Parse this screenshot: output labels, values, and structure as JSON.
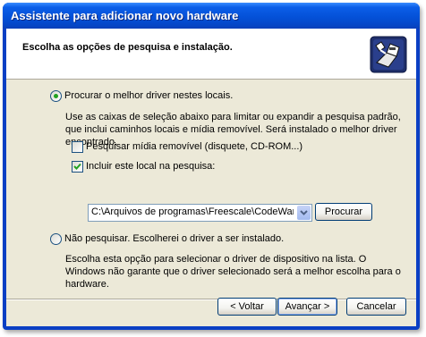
{
  "window": {
    "title": "Assistente para adicionar novo hardware"
  },
  "header": {
    "title": "Escolha as opções de pesquisa e instalação."
  },
  "options": {
    "search": {
      "label": "Procurar o melhor driver nestes locais.",
      "selected": true,
      "description": "Use as caixas de seleção abaixo para limitar ou expandir a pesquisa padrão, que inclui caminhos locais e mídia removível. Será instalado o melhor driver encontrado.",
      "removable_media": {
        "label": "Pesquisar mídia removível (disquete, CD-ROM...)",
        "checked": false
      },
      "include_location": {
        "label": "Incluir este local na pesquisa:",
        "checked": true
      },
      "path_value": "C:\\Arquivos de programas\\Freescale\\CodeWarrior fo",
      "browse_label": "Procurar"
    },
    "manual": {
      "label": "Não pesquisar. Escolherei o driver a ser instalado.",
      "selected": false,
      "description": "Escolha esta opção para selecionar o driver de dispositivo na lista. O Windows não garante que o driver selecionado será a melhor escolha para o hardware."
    }
  },
  "buttons": {
    "back": "< Voltar",
    "next": "Avançar >",
    "cancel": "Cancelar"
  },
  "colors": {
    "titlebar": "#0451d8",
    "dialog_bg": "#ece9d8",
    "radio_dot": "#21a121",
    "check_mark": "#21a121"
  },
  "icons": {
    "wizard": "hardware-wizard-icon",
    "dropdown": "chevron-down-icon"
  }
}
